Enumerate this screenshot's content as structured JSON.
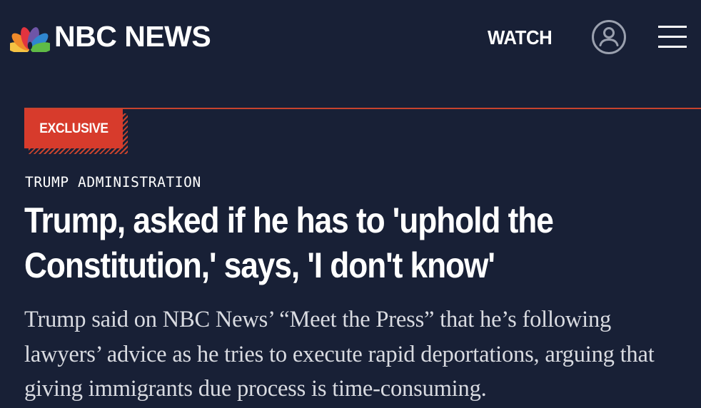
{
  "header": {
    "brand": "NBC NEWS",
    "watch_label": "WATCH",
    "account_icon": "user-circle-icon",
    "menu_icon": "hamburger-menu-icon",
    "peacock_colors": [
      "#f6c343",
      "#ef8a2a",
      "#e2343f",
      "#6e55a7",
      "#2f86d0",
      "#5fbb46"
    ]
  },
  "article": {
    "badge": "EXCLUSIVE",
    "category": "TRUMP ADMINISTRATION",
    "headline": "Trump, asked if he has to 'uphold the Constitution,' says, 'I don't know'",
    "dek": "Trump said on NBC News’ “Meet the Press” that he’s following lawyers’ advice as he tries to execute rapid deportations, arguing that giving immigrants due process is time-consuming."
  },
  "colors": {
    "background": "#182036",
    "accent_red": "#d73b2c",
    "divider": "#c7432e",
    "text": "#ffffff",
    "dek_text": "#d9dbe1"
  }
}
